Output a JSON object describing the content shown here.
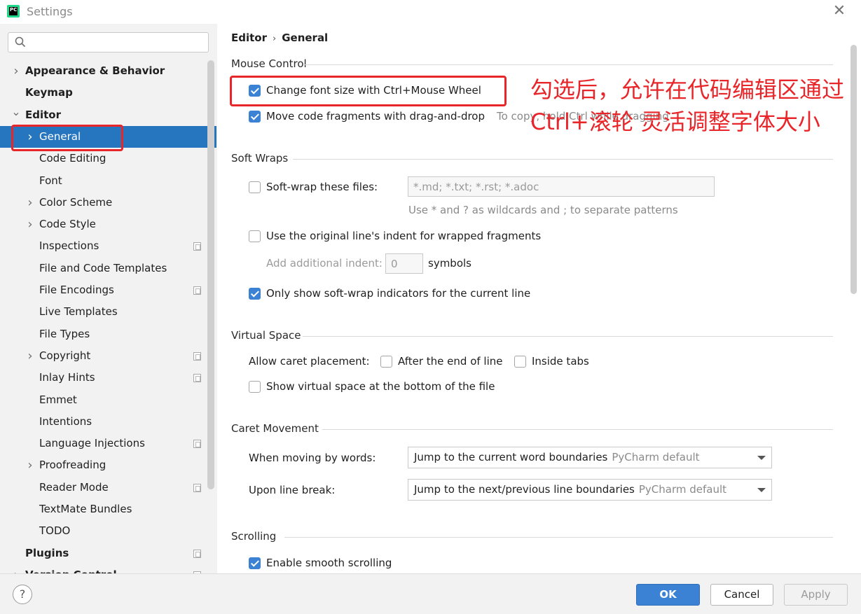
{
  "window": {
    "title": "Settings",
    "app_icon": "pycharm-logo",
    "app_icon_text": "PC",
    "close_icon": "close-icon"
  },
  "search": {
    "placeholder": ""
  },
  "sidebar": {
    "items": [
      {
        "label": "Appearance & Behavior",
        "bold": true,
        "chevron": "right",
        "level": 0
      },
      {
        "label": "Keymap",
        "bold": true,
        "chevron": "",
        "level": 0
      },
      {
        "label": "Editor",
        "bold": true,
        "chevron": "down",
        "level": 0
      },
      {
        "label": "General",
        "bold": false,
        "chevron": "right",
        "level": 1,
        "selected": true
      },
      {
        "label": "Code Editing",
        "chevron": "",
        "level": 1
      },
      {
        "label": "Font",
        "chevron": "",
        "level": 1
      },
      {
        "label": "Color Scheme",
        "chevron": "right",
        "level": 1
      },
      {
        "label": "Code Style",
        "chevron": "right",
        "level": 1
      },
      {
        "label": "Inspections",
        "chevron": "",
        "level": 1,
        "project_icon": true
      },
      {
        "label": "File and Code Templates",
        "chevron": "",
        "level": 1
      },
      {
        "label": "File Encodings",
        "chevron": "",
        "level": 1,
        "project_icon": true
      },
      {
        "label": "Live Templates",
        "chevron": "",
        "level": 1
      },
      {
        "label": "File Types",
        "chevron": "",
        "level": 1
      },
      {
        "label": "Copyright",
        "chevron": "right",
        "level": 1,
        "project_icon": true
      },
      {
        "label": "Inlay Hints",
        "chevron": "",
        "level": 1,
        "project_icon": true
      },
      {
        "label": "Emmet",
        "chevron": "",
        "level": 1
      },
      {
        "label": "Intentions",
        "chevron": "",
        "level": 1
      },
      {
        "label": "Language Injections",
        "chevron": "",
        "level": 1,
        "project_icon": true
      },
      {
        "label": "Proofreading",
        "chevron": "right",
        "level": 1
      },
      {
        "label": "Reader Mode",
        "chevron": "",
        "level": 1,
        "project_icon": true
      },
      {
        "label": "TextMate Bundles",
        "chevron": "",
        "level": 1
      },
      {
        "label": "TODO",
        "chevron": "",
        "level": 1
      },
      {
        "label": "Plugins",
        "bold": true,
        "chevron": "",
        "level": 0,
        "project_icon": true
      },
      {
        "label": "Version Control",
        "bold": true,
        "chevron": "right",
        "level": 0,
        "project_icon": true
      }
    ]
  },
  "breadcrumb": {
    "parent": "Editor",
    "separator": "›",
    "current": "General"
  },
  "sections": {
    "mouse_control": {
      "title": "Mouse Control",
      "change_font": {
        "label": "Change font size with Ctrl+Mouse Wheel",
        "checked": true
      },
      "drag_drop": {
        "label": "Move code fragments with drag-and-drop",
        "checked": true,
        "hint": "To copy, hold Ctrl while dragging"
      }
    },
    "soft_wraps": {
      "title": "Soft Wraps",
      "soft_wrap_files": {
        "label": "Soft-wrap these files:",
        "checked": false,
        "value": "*.md; *.txt; *.rst; *.adoc",
        "hint": "Use * and ? as wildcards and ; to separate patterns"
      },
      "original_indent": {
        "label": "Use the original line's indent for wrapped fragments",
        "checked": false
      },
      "additional_indent": {
        "label": "Add additional indent:",
        "value": "0",
        "unit": "symbols"
      },
      "indicators": {
        "label": "Only show soft-wrap indicators for the current line",
        "checked": true
      }
    },
    "virtual_space": {
      "title": "Virtual Space",
      "caret_label": "Allow caret placement:",
      "after_end": {
        "label": "After the end of line",
        "checked": false
      },
      "inside_tabs": {
        "label": "Inside tabs",
        "checked": false
      },
      "show_bottom": {
        "label": "Show virtual space at the bottom of the file",
        "checked": false
      }
    },
    "caret_movement": {
      "title": "Caret Movement",
      "words": {
        "label": "When moving by words:",
        "value": "Jump to the current word boundaries",
        "default": "PyCharm default"
      },
      "line_break": {
        "label": "Upon line break:",
        "value": "Jump to the next/previous line boundaries",
        "default": "PyCharm default"
      }
    },
    "scrolling": {
      "title": "Scrolling",
      "smooth": {
        "label": "Enable smooth scrolling",
        "checked": true
      }
    }
  },
  "annotation": {
    "line1": "勾选后，允许在代码编辑区通过",
    "line2": "Ctrl+滚轮 灵活调整字体大小",
    "color": "#e8262a"
  },
  "footer": {
    "help": "?",
    "ok": "OK",
    "cancel": "Cancel",
    "apply": "Apply"
  },
  "colors": {
    "accent": "#3b82d4",
    "selection": "#2675bf",
    "sidebar_bg": "#f2f2f2"
  }
}
